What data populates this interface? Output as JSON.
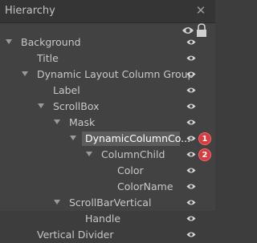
{
  "panel": {
    "title": "Hierarchy",
    "close_icon": "close-icon"
  },
  "rows": [
    {
      "label": "Background",
      "expanded": true,
      "eye": "visible"
    },
    {
      "label": "Title",
      "eye": "visible"
    },
    {
      "label": "Dynamic Layout Column Group",
      "expanded": true,
      "eye": "visible"
    },
    {
      "label": "Label",
      "eye": "visible"
    },
    {
      "label": "ScrollBox",
      "expanded": true,
      "eye": "visible"
    },
    {
      "label": "Mask",
      "expanded": true,
      "eye": "visible"
    },
    {
      "label": "DynamicColumnCo...",
      "expanded": true,
      "selected": true,
      "eye": "visible",
      "badge": "1"
    },
    {
      "label": "ColumnChild",
      "expanded": true,
      "eye": "visible",
      "badge": "2"
    },
    {
      "label": "Color",
      "eye": "visible"
    },
    {
      "label": "ColorName",
      "eye": "visible"
    },
    {
      "label": "ScrollBarVertical",
      "expanded": true,
      "eye": "visible"
    },
    {
      "label": "Handle",
      "eye": "visible"
    },
    {
      "label": "Vertical Divider",
      "eye": "visible"
    }
  ]
}
